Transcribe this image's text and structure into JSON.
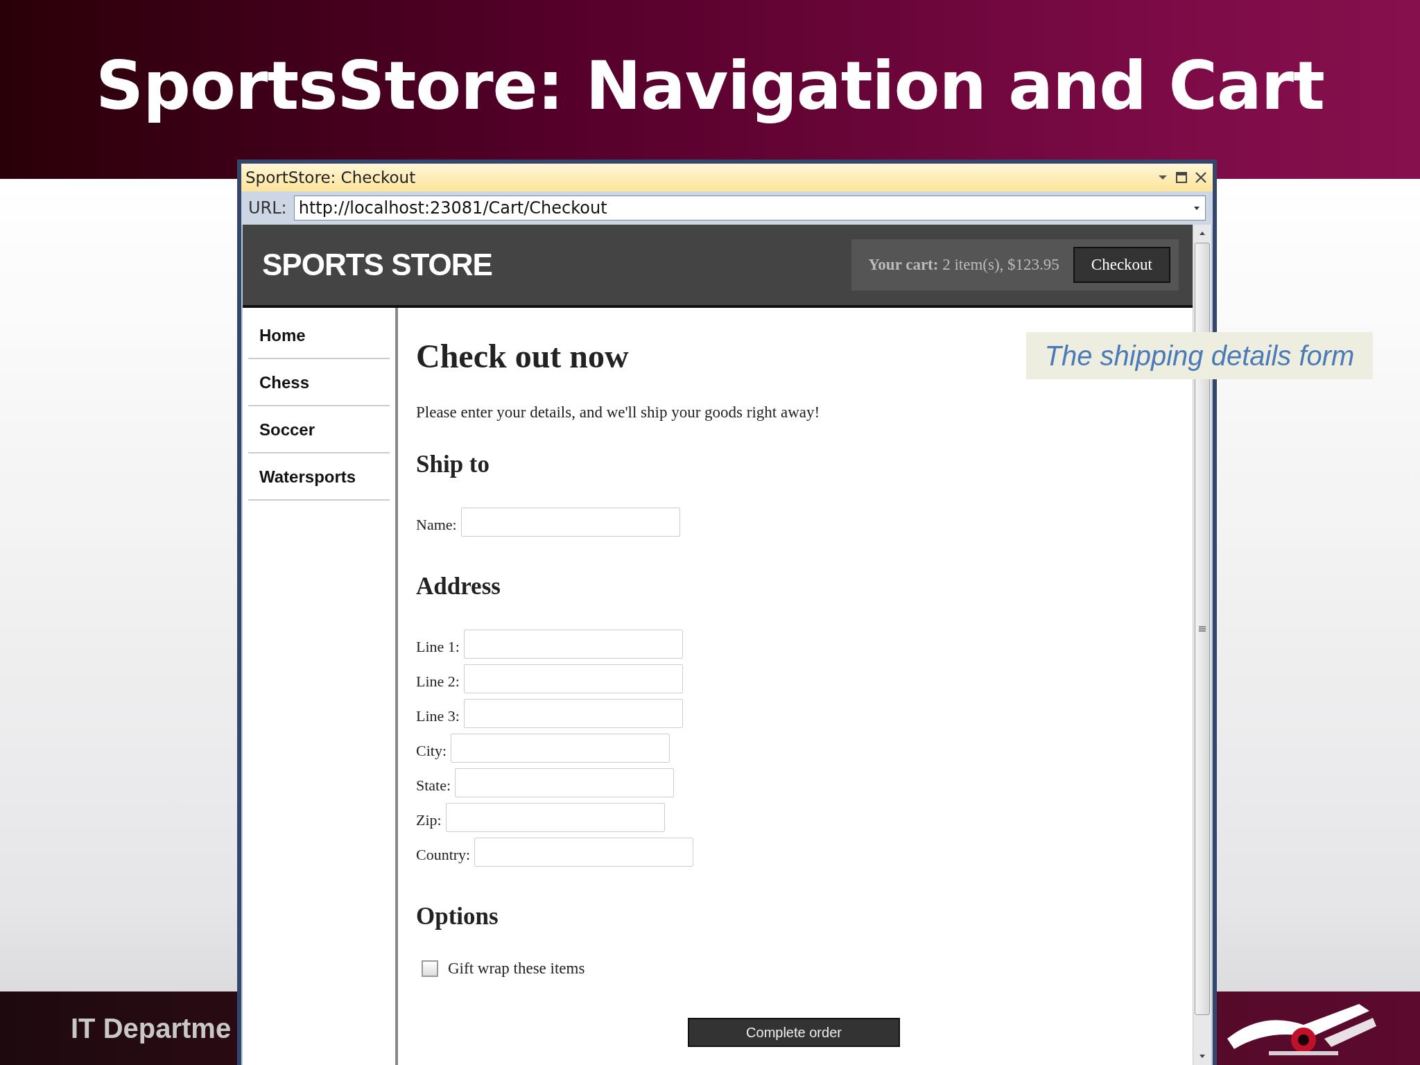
{
  "slide": {
    "title": "SportsStore: Navigation and Cart",
    "footer_text": "IT Departme",
    "callout": "The shipping details form"
  },
  "window": {
    "title": "SportStore: Checkout",
    "url_label": "URL:",
    "url": "http://localhost:23081/Cart/Checkout"
  },
  "site": {
    "logo": "SPORTS STORE",
    "cart_label": "Your cart:",
    "cart_summary": "2 item(s), $123.95",
    "checkout_button": "Checkout"
  },
  "nav": [
    {
      "label": "Home"
    },
    {
      "label": "Chess"
    },
    {
      "label": "Soccer"
    },
    {
      "label": "Watersports"
    }
  ],
  "page": {
    "heading": "Check out now",
    "intro": "Please enter your details, and we'll ship your goods right away!",
    "sections": [
      {
        "heading": "Ship to",
        "fields": [
          {
            "label": "Name:"
          }
        ]
      },
      {
        "heading": "Address",
        "fields": [
          {
            "label": "Line 1:"
          },
          {
            "label": "Line 2:"
          },
          {
            "label": "Line 3:"
          },
          {
            "label": "City:"
          },
          {
            "label": "State:"
          },
          {
            "label": "Zip:"
          },
          {
            "label": "Country:"
          }
        ]
      },
      {
        "heading": "Options",
        "checkboxes": [
          {
            "label": "Gift wrap these items",
            "checked": false
          }
        ]
      }
    ],
    "submit": "Complete order"
  }
}
